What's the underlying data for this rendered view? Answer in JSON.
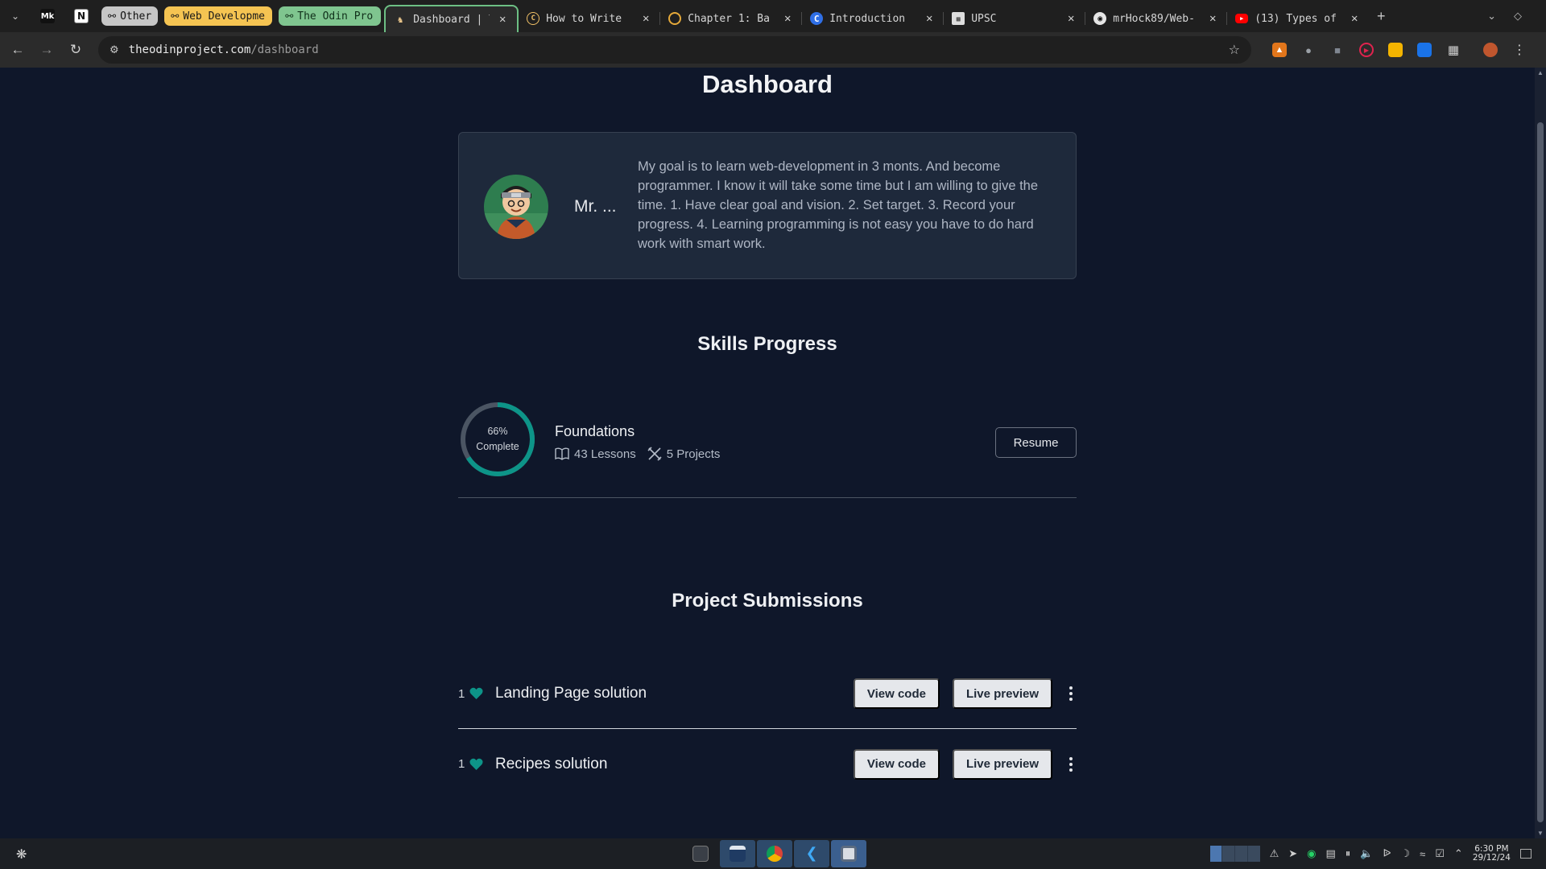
{
  "browser": {
    "pinned_tabs": [
      {
        "name": "medium",
        "glyph": "Mk"
      },
      {
        "name": "notion",
        "glyph": "N"
      }
    ],
    "tab_groups": [
      {
        "label": "Other",
        "color": "#c6c6c6",
        "text_color": "#111111"
      },
      {
        "label": "Web Developme",
        "color": "#f5c452",
        "text_color": "#1a1a1a"
      },
      {
        "label": "The Odin Pro",
        "color": "#7fc58f",
        "text_color": "#10301a"
      }
    ],
    "tabs": [
      {
        "title": "Dashboard | T",
        "icon": "odin-icon",
        "active": true
      },
      {
        "title": "How to Write",
        "icon": "copyright-icon"
      },
      {
        "title": "Chapter 1: Ba",
        "icon": "ring-icon"
      },
      {
        "title": "Introduction",
        "icon": "c-icon"
      },
      {
        "title": "UPSC",
        "icon": "upsc-icon"
      },
      {
        "title": "mrHock89/Web-",
        "icon": "github-icon"
      },
      {
        "title": "(13) Types of",
        "icon": "youtube-icon"
      }
    ],
    "url_host": "theodinproject.com",
    "url_path": "/dashboard"
  },
  "dashboard": {
    "title": "Dashboard",
    "profile": {
      "name": "Mr. ...",
      "bio": "My goal is to learn web-development in 3 monts. And become programmer. I know it will take some time but I am willing to give the time. 1. Have clear goal and vision. 2. Set target. 3. Record your progress. 4. Learning programming is not easy you have to do hard work with smart work."
    },
    "skills_title": "Skills Progress",
    "skills": [
      {
        "name": "Foundations",
        "percent": 66,
        "percent_label": "66%",
        "complete_label": "Complete",
        "lessons": "43 Lessons",
        "projects": "5 Projects",
        "button": "Resume"
      }
    ],
    "submissions_title": "Project Submissions",
    "submissions": [
      {
        "likes": "1",
        "name": "Landing Page solution",
        "view_code": "View code",
        "live_preview": "Live preview"
      },
      {
        "likes": "1",
        "name": "Recipes solution",
        "view_code": "View code",
        "live_preview": "Live preview"
      }
    ],
    "accent_color": "#0d9488"
  },
  "taskbar": {
    "time": "6:30 PM",
    "date": "29/12/24"
  }
}
